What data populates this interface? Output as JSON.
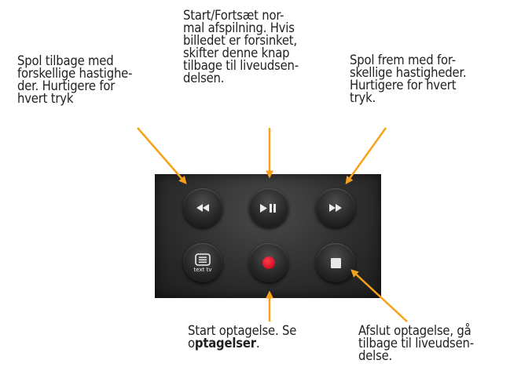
{
  "callouts": {
    "rewind": "Spol tilbage med\nforskellige hastighe-\nder. Hurtigere for\nhvert tryk",
    "play_pause": "Start/Fortsæt nor-\nmal afspilning. Hvis\nbilledet er forsinket,\nskifter denne knap\ntilbage til liveudsen-\ndelsen.",
    "fast_forward": "Spol frem med for-\nskellige hastigheder.\nHurtigere for hvert\ntryk.",
    "record": {
      "text_before": "Start optagelse. Se\no",
      "link": "ptagelser",
      "text_after": "."
    },
    "stop": "Afslut optagelse, gå\ntilbage til liveudsen-\ndelse."
  },
  "remote": {
    "buttons": {
      "text_tv_label": "text tv"
    }
  },
  "colors": {
    "arrow": "#f7a21b",
    "record": "#e0142a"
  }
}
